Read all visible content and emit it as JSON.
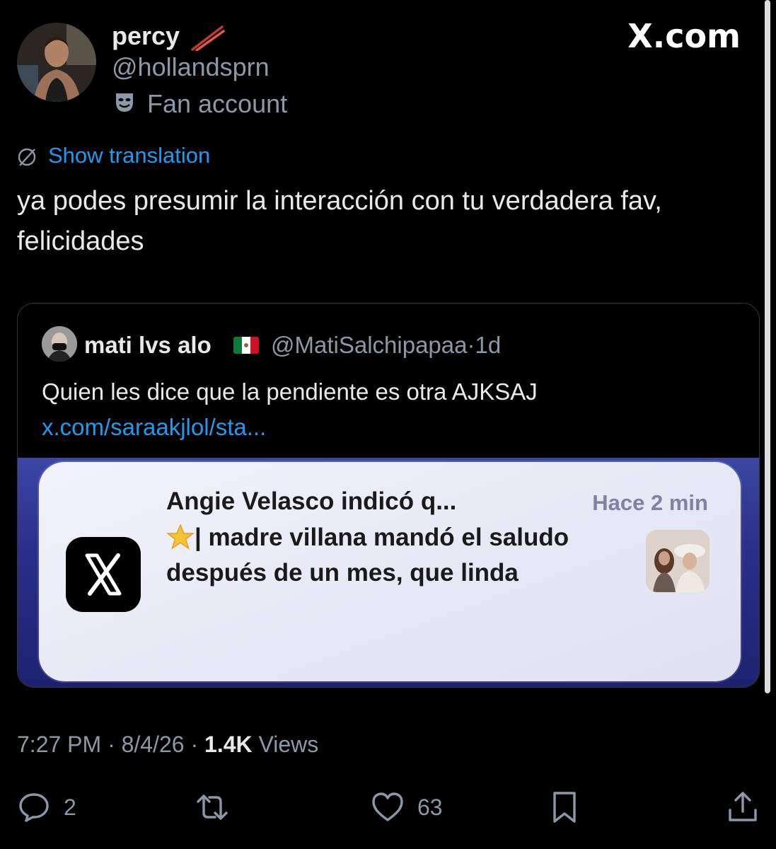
{
  "author": {
    "name": "percy",
    "handle": "@hollandsprn",
    "label": "Fan account",
    "name_emoji": "chopsticks-icon",
    "label_icon": "performing-arts-mask-icon"
  },
  "brand": {
    "logo_text": "X.com"
  },
  "translation": {
    "label": "Show translation"
  },
  "tweet": {
    "text": "ya podes presumir la interacción con tu verdadera fav, felicidades"
  },
  "quote": {
    "name": "mati lvs alo",
    "flag": "mexico-flag-icon",
    "handle": "@MatiSalchipapaa",
    "separator": "·",
    "time": "1d",
    "text": "Quien les dice que la pendiente es otra AJKSAJ ",
    "link": "x.com/saraakjlol/sta...",
    "image": {
      "notification_title": "Angie Velasco indicó q...",
      "notification_time": "Hace 2 min",
      "notification_body": "| madre villana mandó el saludo después de un mes, que linda",
      "app_icon": "x-app-icon"
    }
  },
  "meta": {
    "time": "7:27 PM",
    "date": "8/4/26",
    "views_count": "1.4K",
    "views_label": "Views",
    "separator": "·"
  },
  "actions": {
    "reply_count": "2",
    "like_count": "63"
  },
  "colors": {
    "background": "#000000",
    "text": "#e7e9ea",
    "secondary": "#8b98a5",
    "link": "#1d9bf0",
    "border": "#333639"
  }
}
